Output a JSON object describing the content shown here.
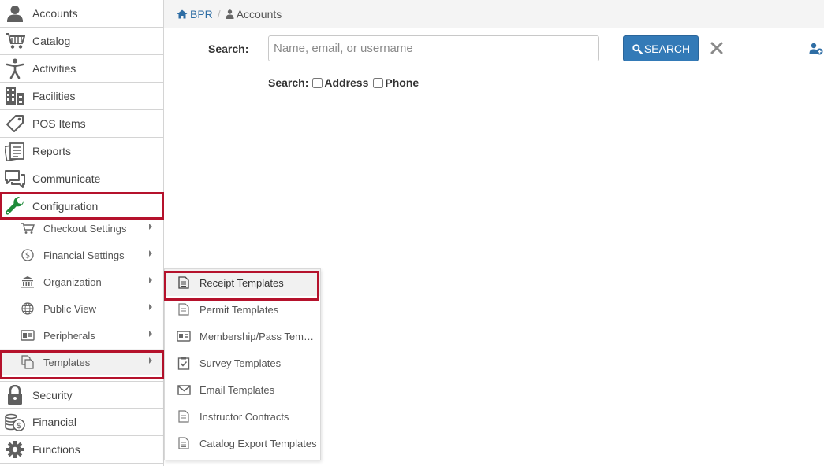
{
  "sidebar": {
    "items_top": [
      {
        "label": "Accounts",
        "icon": "user-icon"
      },
      {
        "label": "Catalog",
        "icon": "cart-icon"
      },
      {
        "label": "Activities",
        "icon": "person-activity-icon"
      },
      {
        "label": "Facilities",
        "icon": "building-icon"
      },
      {
        "label": "POS Items",
        "icon": "tag-icon"
      },
      {
        "label": "Reports",
        "icon": "reports-icon"
      },
      {
        "label": "Communicate",
        "icon": "chat-icon"
      },
      {
        "label": "Configuration",
        "icon": "wrench-icon"
      }
    ],
    "configuration_sub": [
      {
        "label": "Checkout Settings",
        "icon": "cart-icon"
      },
      {
        "label": "Financial Settings",
        "icon": "dollar-circle-icon"
      },
      {
        "label": "Organization",
        "icon": "bank-icon"
      },
      {
        "label": "Public View",
        "icon": "globe-icon"
      },
      {
        "label": "Peripherals",
        "icon": "id-card-icon"
      },
      {
        "label": "Templates",
        "icon": "templates-icon"
      }
    ],
    "items_bottom": [
      {
        "label": "Security",
        "icon": "lock-icon"
      },
      {
        "label": "Financial",
        "icon": "coins-icon"
      },
      {
        "label": "Functions",
        "icon": "gear-icon"
      }
    ],
    "accent_color": "#b5122c",
    "wrench_color": "#1f8b3a"
  },
  "breadcrumb": {
    "home": "BPR",
    "separator": "/",
    "current": "Accounts"
  },
  "search": {
    "label": "Search:",
    "placeholder": "Name, email, or username",
    "value": "",
    "button_label": "SEARCH",
    "options_label": "Search:",
    "options": [
      {
        "label": "Address",
        "checked": false
      },
      {
        "label": "Phone",
        "checked": false
      }
    ],
    "button_color": "#337ab7"
  },
  "flyout": {
    "items": [
      {
        "label": "Receipt Templates",
        "icon": "document-icon"
      },
      {
        "label": "Permit Templates",
        "icon": "document-icon"
      },
      {
        "label": "Membership/Pass Templ...",
        "icon": "id-card-icon"
      },
      {
        "label": "Survey Templates",
        "icon": "clipboard-check-icon"
      },
      {
        "label": "Email Templates",
        "icon": "envelope-icon"
      },
      {
        "label": "Instructor Contracts",
        "icon": "document-icon"
      },
      {
        "label": "Catalog Export Templates",
        "icon": "document-icon"
      }
    ]
  }
}
